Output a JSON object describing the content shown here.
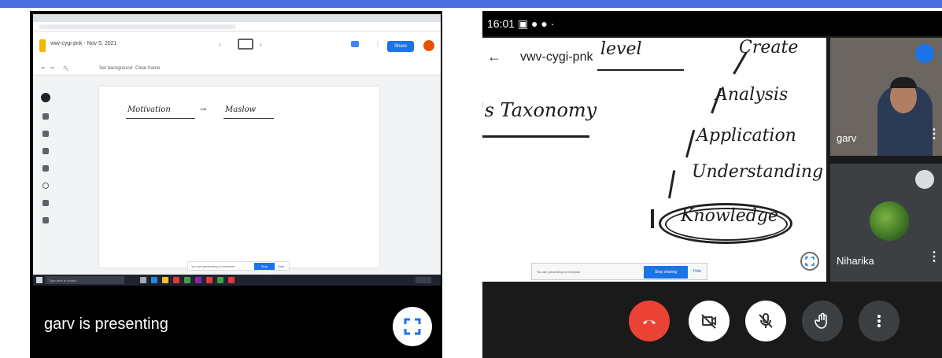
{
  "left_panel": {
    "presenting_label": "garv is presenting",
    "jamboard": {
      "title": "vwv-cygi-pnk - Nov 5, 2021",
      "share_label": "Share",
      "toolbar": {
        "set_background": "Set background",
        "clear_frame": "Clear frame"
      },
      "handwriting": {
        "word1": "Motivation",
        "arrow": "→",
        "word2": "Maslow"
      },
      "presenting_pill": {
        "message": "You are presenting to everyone",
        "stop_label": "Stop presenting",
        "hide_label": "Hide"
      },
      "taskbar_search": "Type here to search"
    }
  },
  "right_panel": {
    "status_time": "16:01",
    "meeting_code": "vwv-cygi-pnk",
    "whiteboard": {
      "level": "level",
      "create": "Create",
      "taxonomy": "'s Taxonomy",
      "analysis": "Analysis",
      "application": "Application",
      "understanding": "Understanding",
      "knowledge": "Knowledge"
    },
    "share_banner": {
      "message": "You are presenting to everyone",
      "stop_label": "Stop sharing",
      "hide_label": "Hide"
    },
    "participants": [
      {
        "name": "garv",
        "mic": "on"
      },
      {
        "name": "Niharika",
        "mic": "off"
      }
    ],
    "controls": [
      "end-call",
      "camera-off",
      "mic-off",
      "raise-hand",
      "more-options"
    ]
  },
  "colors": {
    "accent_bar": "#4a6fe3",
    "end_call": "#ea4335",
    "meet_blue": "#1a73e8"
  }
}
